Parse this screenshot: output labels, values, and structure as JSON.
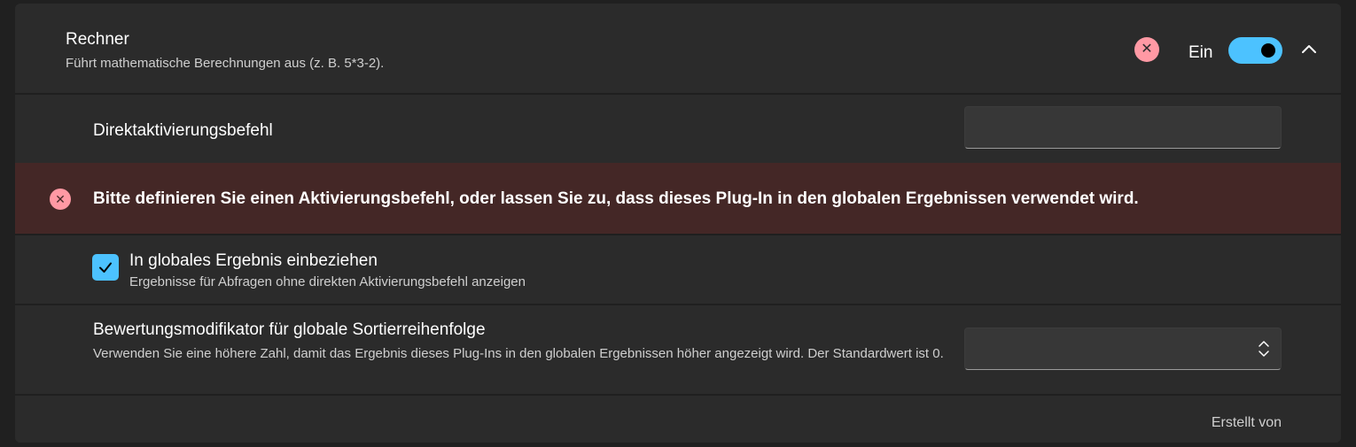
{
  "plugin": {
    "title": "Rechner",
    "description": "Führt mathematische Berechnungen aus (z. B. 5*3-2).",
    "error_icon": "close-icon",
    "toggle_label": "Ein",
    "toggle_on": true,
    "expand_icon": "chevron-up-icon"
  },
  "direct_activation": {
    "label": "Direktaktivierungsbefehl",
    "value": "",
    "placeholder": ""
  },
  "error": {
    "icon": "close-circle-icon",
    "message": "Bitte definieren Sie einen Aktivierungsbefehl, oder lassen Sie zu, dass dieses Plug-In in den globalen Ergebnissen verwendet wird."
  },
  "global_result": {
    "checked": true,
    "label": "In globales Ergebnis einbeziehen",
    "description": "Ergebnisse für Abfragen ohne direkten Aktivierungsbefehl anzeigen"
  },
  "score_modifier": {
    "label": "Bewertungsmodifikator für globale Sortierreihenfolge",
    "description": "Verwenden Sie eine höhere Zahl, damit das Ergebnis dieses Plug-Ins in den globalen Ergebnissen höher angezeigt wird. Der Standardwert ist 0.",
    "value": ""
  },
  "footer": {
    "author_label": "Erstellt von"
  },
  "colors": {
    "accent": "#4cc2ff",
    "error_bg": "#442726",
    "error_icon": "#ff99a4",
    "card_bg": "#2b2b2b",
    "page_bg": "#202020"
  }
}
